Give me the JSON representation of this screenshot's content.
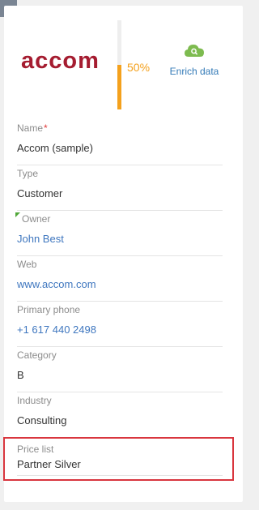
{
  "header": {
    "logo_text": "accom",
    "brand_color": "#a51c30",
    "completeness": {
      "percent": 50,
      "label": "50%",
      "color": "#f4a11d"
    },
    "enrich": {
      "label": "Enrich data",
      "icon": "cloud-search-icon",
      "icon_color": "#7dbb4f"
    }
  },
  "fields": [
    {
      "label": "Name",
      "value": "Accom (sample)",
      "required": true,
      "link": false
    },
    {
      "label": "Type",
      "value": "Customer",
      "required": false,
      "link": false
    },
    {
      "label": "Owner",
      "value": "John Best",
      "required": false,
      "link": true
    },
    {
      "label": "Web",
      "value": "www.accom.com",
      "required": false,
      "link": true
    },
    {
      "label": "Primary phone",
      "value": "+1 617 440 2498",
      "required": false,
      "link": true
    },
    {
      "label": "Category",
      "value": "B",
      "required": false,
      "link": false
    },
    {
      "label": "Industry",
      "value": "Consulting",
      "required": false,
      "link": false
    }
  ],
  "price_list": {
    "label": "Price list",
    "value": "Partner Silver",
    "highlight_color": "#d9363e"
  },
  "required_marker": "*",
  "corner_icon": "chevron-right-icon"
}
